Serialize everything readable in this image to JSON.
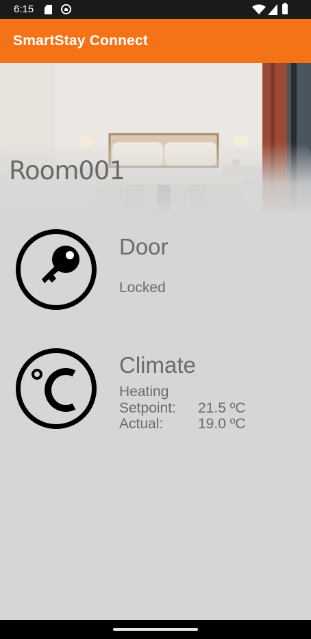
{
  "status_bar": {
    "time": "6:15",
    "icons": [
      "sd-card-icon",
      "camera-icon",
      "wifi-icon",
      "signal-icon",
      "battery-icon"
    ]
  },
  "app_bar": {
    "title": "SmartStay Connect",
    "color": "#f47316"
  },
  "room": {
    "name": "Room001",
    "photo": "hotel-bedroom-photo"
  },
  "door": {
    "title": "Door",
    "status": "Locked",
    "icon": "key-icon"
  },
  "climate": {
    "title": "Climate",
    "mode": "Heating",
    "setpoint_label": "Setpoint:",
    "setpoint_value": "21.5 ºC",
    "actual_label": "Actual:",
    "actual_value": "19.0 ºC",
    "icon": "celsius-icon"
  },
  "colors": {
    "background": "#d6d6d6",
    "text": "#6b6b6b",
    "status_bar": "#1a1a1a"
  }
}
